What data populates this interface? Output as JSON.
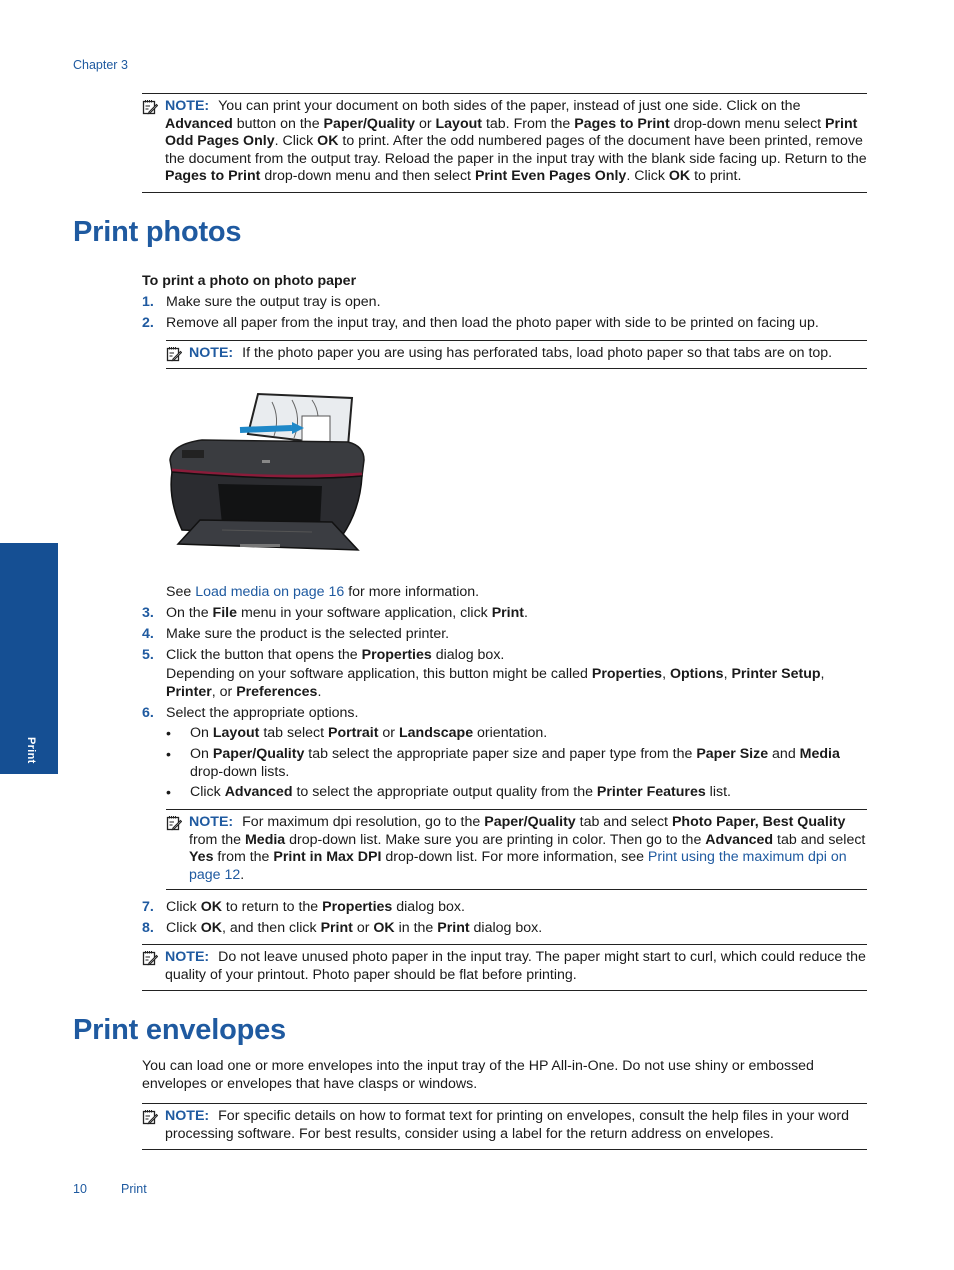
{
  "header": {
    "chapter": "Chapter 3"
  },
  "side_tab": {
    "label": "Print"
  },
  "note_label": "NOTE:",
  "note1": {
    "t1": "You can print your document on both sides of the paper, instead of just one side. Click on the ",
    "b1": "Advanced",
    "t2": " button on the ",
    "b2": "Paper/Quality",
    "t3": " or ",
    "b3": "Layout",
    "t4": " tab. From the ",
    "b4": "Pages to Print",
    "t5": " drop-down menu select ",
    "b5": "Print Odd Pages Only",
    "t6": ". Click ",
    "b6": "OK",
    "t7": " to print. After the odd numbered pages of the document have been printed, remove the document from the output tray. Reload the paper in the input tray with the blank side facing up. Return to the ",
    "b7": "Pages to Print",
    "t8": " drop-down menu and then select ",
    "b8": "Print Even Pages Only",
    "t9": ". Click ",
    "b9": "OK",
    "t10": " to print."
  },
  "print_photos": {
    "title": "Print photos",
    "procedure_title": "To print a photo on photo paper",
    "step1": {
      "num": "1.",
      "text": "Make sure the output tray is open."
    },
    "step2": {
      "num": "2.",
      "text": "Remove all paper from the input tray, and then load the photo paper with side to be printed on facing up."
    },
    "note2": "If the photo paper you are using has perforated tabs, load photo paper so that tabs are on top.",
    "image_alt": "printer-loading-photo-paper",
    "see": {
      "t1": "See ",
      "link": "Load media on page 16",
      "t2": " for more information."
    },
    "step3": {
      "num": "3.",
      "t1": "On the ",
      "b1": "File",
      "t2": " menu in your software application, click ",
      "b2": "Print",
      "t3": "."
    },
    "step4": {
      "num": "4.",
      "text": "Make sure the product is the selected printer."
    },
    "step5": {
      "num": "5.",
      "t1": "Click the button that opens the ",
      "b1": "Properties",
      "t2": " dialog box.",
      "d1": "Depending on your software application, this button might be called ",
      "db1": "Properties",
      "d2": ", ",
      "db2": "Options",
      "d3": ", ",
      "db3": "Printer Setup",
      "d4": ", ",
      "db4": "Printer",
      "d5": ", or ",
      "db5": "Preferences",
      "d6": "."
    },
    "step6": {
      "num": "6.",
      "text": "Select the appropriate options."
    },
    "bullets": {
      "glyph": "•",
      "b1": {
        "t1": "On ",
        "b1": "Layout",
        "t2": " tab select ",
        "b2": "Portrait",
        "t3": " or ",
        "b3": "Landscape",
        "t4": " orientation."
      },
      "b2": {
        "t1": "On ",
        "b1": "Paper/Quality",
        "t2": " tab select the appropriate paper size and paper type from the ",
        "b2": "Paper Size",
        "t3": " and ",
        "b3": "Media",
        "t4": " drop-down lists."
      },
      "b3": {
        "t1": "Click ",
        "b1": "Advanced",
        "t2": " to select the appropriate output quality from the ",
        "b2": "Printer Features",
        "t3": " list."
      }
    },
    "note3": {
      "t1": "For maximum dpi resolution, go to the ",
      "b1": "Paper/Quality",
      "t2": " tab and select ",
      "b2": "Photo Paper, Best Quality",
      "t3": " from the ",
      "b3": "Media",
      "t4": " drop-down list. Make sure you are printing in color. Then go to the ",
      "b4": "Advanced",
      "t5": " tab and select ",
      "b5": "Yes",
      "t6": " from the ",
      "b6": "Print in Max DPI",
      "t7": " drop-down list. For more information, see ",
      "link": "Print using the maximum dpi on page 12",
      "t8": "."
    },
    "step7": {
      "num": "7.",
      "t1": "Click ",
      "b1": "OK",
      "t2": " to return to the ",
      "b2": "Properties",
      "t3": " dialog box."
    },
    "step8": {
      "num": "8.",
      "t1": "Click ",
      "b1": "OK",
      "t2": ", and then click ",
      "b2": "Print",
      "t3": " or ",
      "b3": "OK",
      "t4": " in the ",
      "b4": "Print",
      "t5": " dialog box."
    },
    "note4": "Do not leave unused photo paper in the input tray. The paper might start to curl, which could reduce the quality of your printout. Photo paper should be flat before printing."
  },
  "print_envelopes": {
    "title": "Print envelopes",
    "intro": "You can load one or more envelopes into the input tray of the HP All-in-One. Do not use shiny or embossed envelopes or envelopes that have clasps or windows.",
    "note": "For specific details on how to format text for printing on envelopes, consult the help files in your word processing software. For best results, consider using a label for the return address on envelopes."
  },
  "footer": {
    "page_number": "10",
    "section": "Print"
  }
}
